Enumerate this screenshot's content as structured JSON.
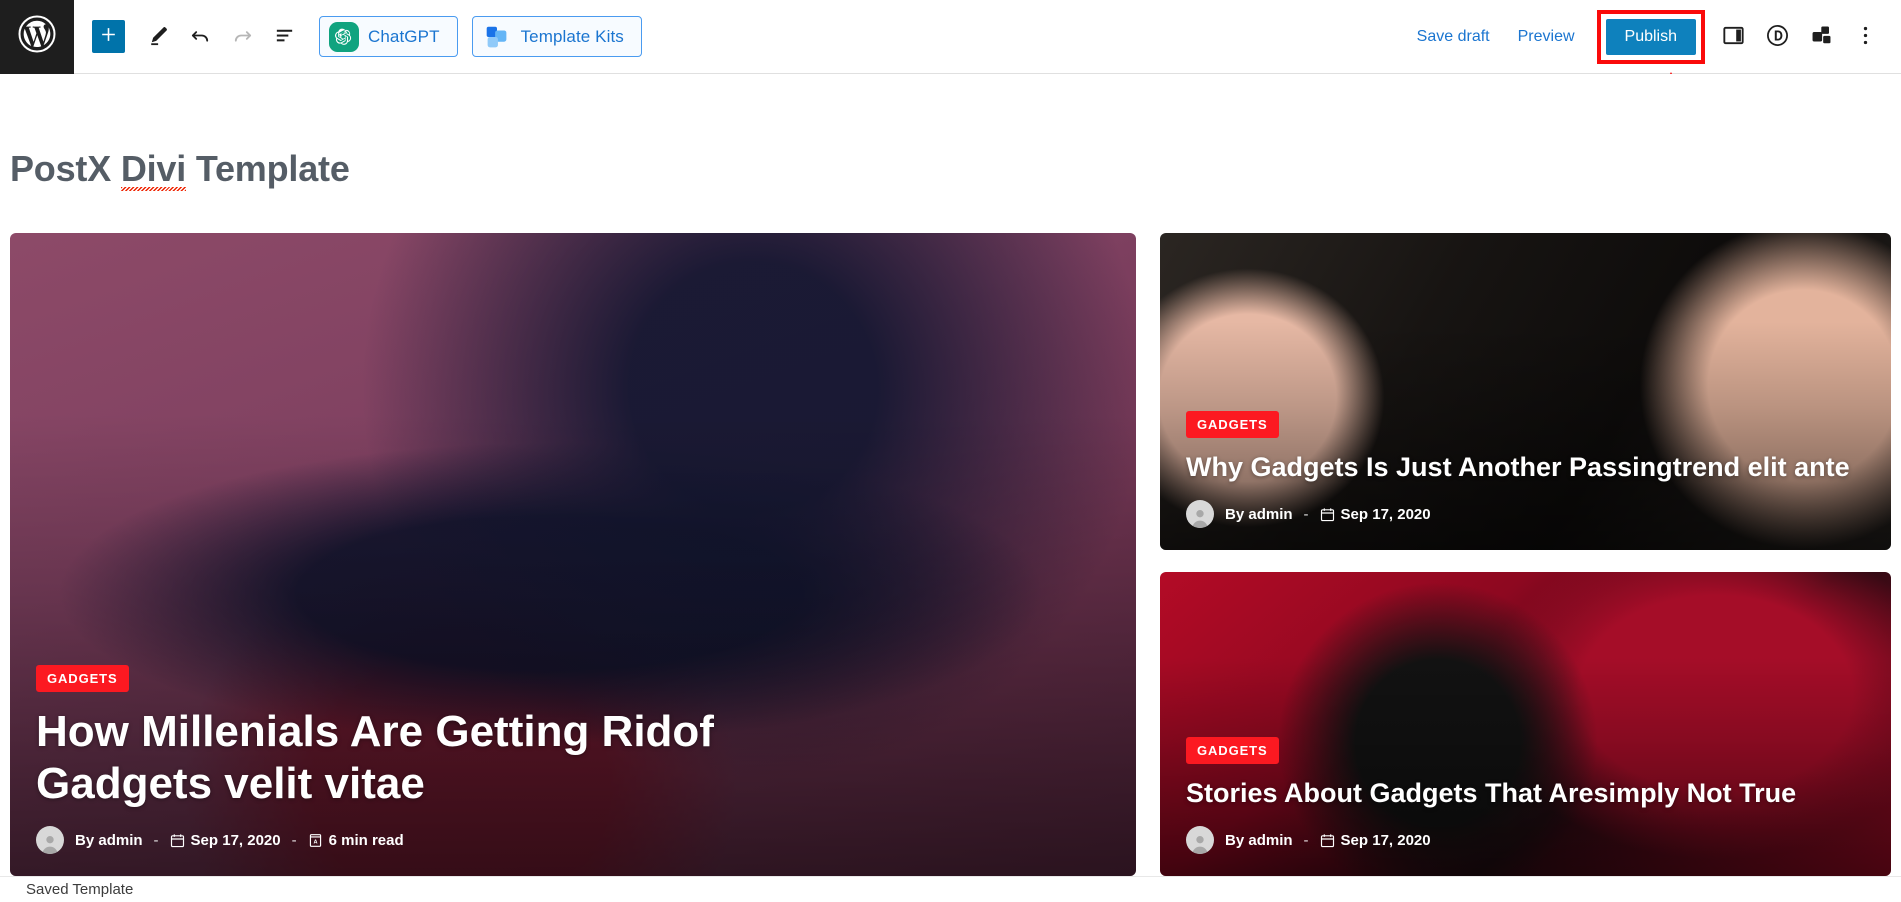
{
  "editor_bar": {
    "logo_name": "wordpress-logo",
    "left_tools": [
      {
        "name": "add-block-button",
        "icon": "plus-icon",
        "label": "Add block"
      },
      {
        "name": "tools-button",
        "icon": "pencil-icon",
        "label": "Tools"
      },
      {
        "name": "undo-button",
        "icon": "undo-arrow-icon",
        "label": "Undo"
      },
      {
        "name": "redo-button",
        "icon": "redo-arrow-icon",
        "label": "Redo",
        "disabled": true
      },
      {
        "name": "list-view-button",
        "icon": "list-view-icon",
        "label": "List View"
      }
    ],
    "plugin_buttons": [
      {
        "name": "chatgpt-button",
        "label": "ChatGPT",
        "icon": "chatgpt-icon",
        "accent": "#1b75d0"
      },
      {
        "name": "template-kits-button",
        "label": "Template Kits",
        "icon": "template-kits-icon",
        "accent": "#1b75d0"
      }
    ],
    "save_draft_label": "Save draft",
    "preview_label": "Preview",
    "publish_label": "Publish",
    "right_icons": [
      {
        "name": "settings-sidebar-toggle",
        "icon": "sidebar-panel-icon"
      },
      {
        "name": "divi-button",
        "icon": "divi-d-logo-icon"
      },
      {
        "name": "template-kits-library-button",
        "icon": "blocks-stack-icon"
      },
      {
        "name": "options-menu-button",
        "icon": "three-dots-vertical-icon"
      }
    ],
    "colors": {
      "publish_bg": "#0e81bd",
      "add_block_bg": "#0073aa",
      "link_blue": "#1b75d0",
      "annotation_red": "#fa0a0a",
      "logo_bg": "#1e1e1e"
    }
  },
  "annotation": {
    "name": "publish-highlight-arrow",
    "color": "#fa0a0a",
    "points_to": "Publish"
  },
  "document": {
    "title": "PostX ",
    "title_misspelled_word": "Divi",
    "title_suffix": " Template"
  },
  "posts": {
    "featured": {
      "category": "GADGETS",
      "title": "How Millenials Are Getting Ridof Gadgets velit vitae",
      "author_prefix": "By",
      "author": "admin",
      "separator": "-",
      "date": "Sep 17, 2020",
      "read_time": "6 min read",
      "image_name": "ronin-gimbal-photo"
    },
    "sidebar": [
      {
        "category": "GADGETS",
        "title": "Why Gadgets Is Just Another Passingtrend elit ante",
        "author_prefix": "By",
        "author": "admin",
        "separator": "-",
        "date": "Sep 17, 2020",
        "image_name": "tablet-lettering-photo"
      },
      {
        "category": "GADGETS",
        "title": "Stories About Gadgets That Aresimply Not True",
        "author_prefix": "By",
        "author": "admin",
        "separator": "-",
        "date": "Sep 17, 2020",
        "image_name": "red-smartwatch-photo"
      }
    ]
  },
  "status_bar": {
    "message": "Saved Template"
  }
}
